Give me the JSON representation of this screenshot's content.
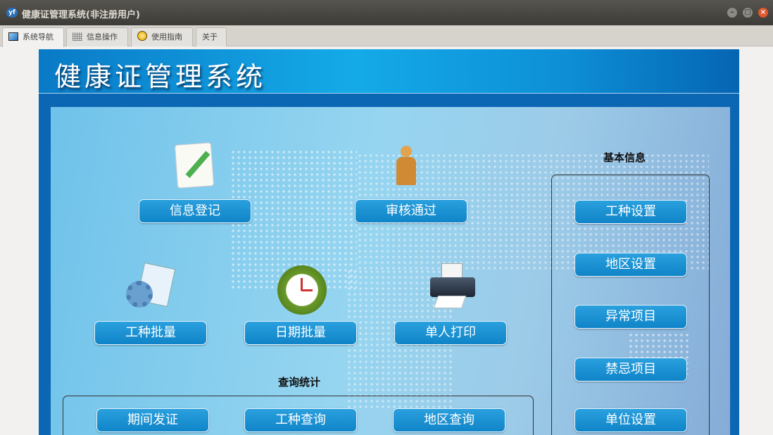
{
  "window": {
    "title": "健康证管理系统(非注册用户)",
    "logo": "yf"
  },
  "tabs": [
    {
      "label": "系统导航",
      "icon": "monitor-icon"
    },
    {
      "label": "信息操作",
      "icon": "grid-icon"
    },
    {
      "label": "使用指南",
      "icon": "help-icon"
    },
    {
      "label": "关于"
    }
  ],
  "header": {
    "title": "健康证管理系统"
  },
  "main": {
    "buttons": [
      "信息登记",
      "审核通过",
      "工种批量",
      "日期批量",
      "单人打印"
    ]
  },
  "query": {
    "label": "查询统计",
    "buttons": [
      "期间发证",
      "工种查询",
      "地区查询"
    ]
  },
  "basic": {
    "label": "基本信息",
    "buttons": [
      "工种设置",
      "地区设置",
      "异常项目",
      "禁忌项目",
      "单位设置"
    ]
  }
}
